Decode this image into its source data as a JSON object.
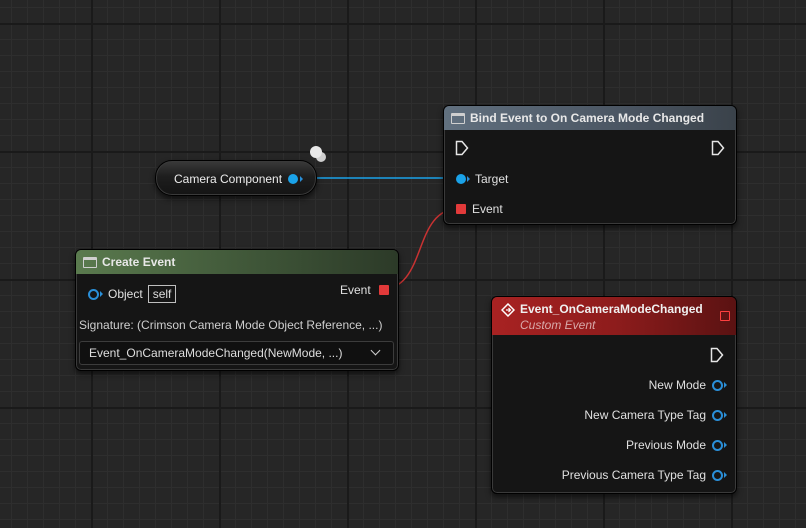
{
  "colors": {
    "object_pin": "#1aa2e8",
    "event_pin": "#e23a3a",
    "function_header": "#5b6a79",
    "create_event_header": "#4e6a44",
    "custom_event_header": "#9b1f1f",
    "grid_bg": "#262626"
  },
  "camera_component_node": {
    "label": "Camera Component"
  },
  "bind_event_node": {
    "title": "Bind Event to On Camera Mode Changed",
    "icon": "function-icon",
    "pins": {
      "target_label": "Target",
      "event_label": "Event"
    }
  },
  "create_event_node": {
    "title": "Create Event",
    "icon": "function-icon",
    "object_label": "Object",
    "self_label": "self",
    "event_output_label": "Event",
    "signature": "Signature: (Crimson Camera Mode Object Reference, ...)",
    "selected_function": "Event_OnCameraModeChanged(NewMode, ...)"
  },
  "custom_event_node": {
    "title": "Event_OnCameraModeChanged",
    "subtitle": "Custom Event",
    "icon": "event-diamond-icon",
    "outputs": [
      {
        "label": "New Mode"
      },
      {
        "label": "New Camera Type Tag"
      },
      {
        "label": "Previous Mode"
      },
      {
        "label": "Previous Camera Type Tag"
      }
    ]
  }
}
